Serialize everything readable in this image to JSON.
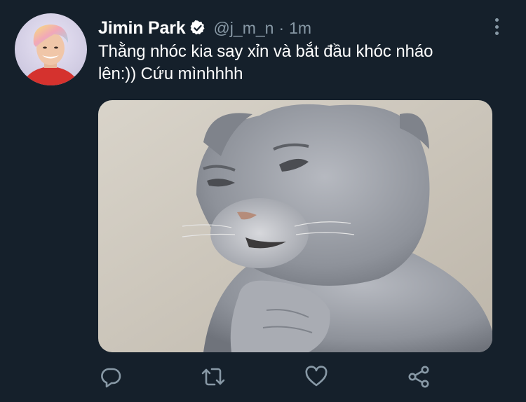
{
  "user": {
    "display_name": "Jimin Park",
    "handle": "@j_m_n",
    "separator": "·",
    "time": "1m"
  },
  "tweet": {
    "text_line1": "Thằng nhóc kia say xỉn và bắt đầu khóc nháo",
    "text_line2": "lên:)) Cứu mìnhhhh"
  },
  "icons": {
    "verified": "verified-badge-icon",
    "more": "more-options-icon",
    "reply": "reply-icon",
    "retweet": "retweet-icon",
    "like": "heart-icon",
    "share": "share-icon"
  },
  "colors": {
    "background": "#15202b",
    "secondary_text": "#8899a6",
    "primary_text": "#ffffff"
  }
}
